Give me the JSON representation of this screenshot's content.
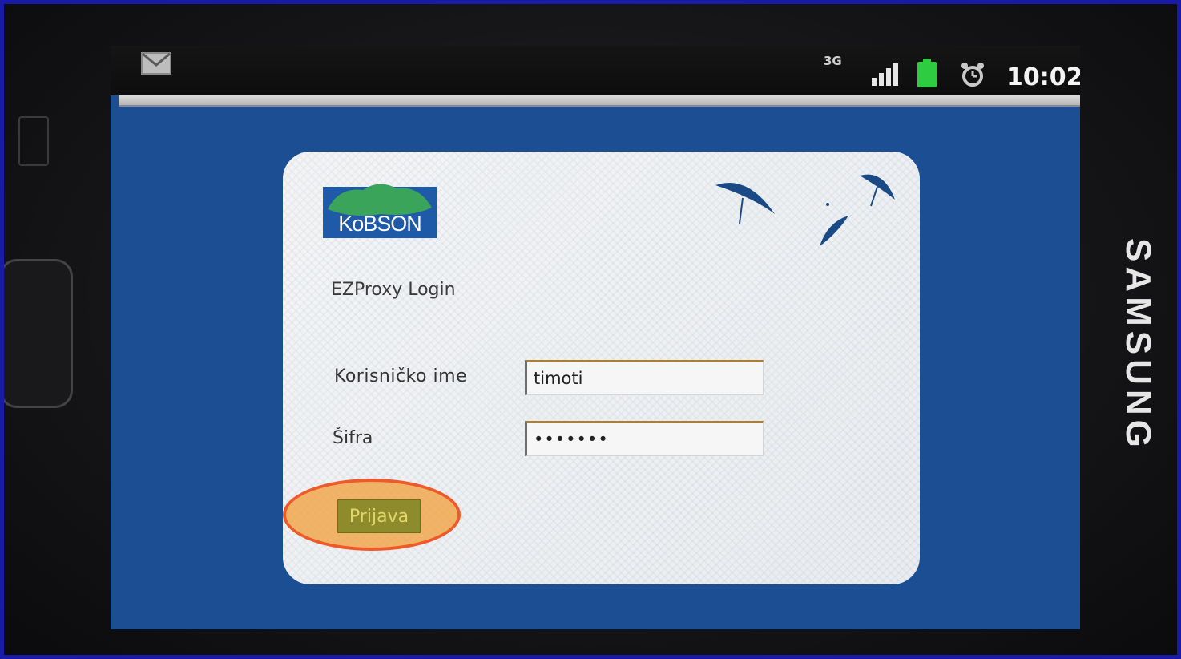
{
  "device": {
    "brand": "SAMSUNG"
  },
  "statusbar": {
    "network_type": "3G",
    "time": "10:02",
    "icons": [
      "gmail-icon",
      "signal-icon",
      "battery-icon",
      "alarm-icon"
    ],
    "battery_color": "#2ecc40"
  },
  "login": {
    "logo_text": "KoBSON",
    "title": "EZProxy Login",
    "username_label": "Korisničko ime",
    "username_value": "timoti",
    "password_label": "Šifra",
    "password_value": "timoti1",
    "submit_label": "Prijava"
  },
  "colors": {
    "screen_background": "#1b4e93",
    "highlight_fill": "#f0a84e",
    "highlight_stroke": "#ef5a2a",
    "button_background": "#8e8b2c"
  }
}
